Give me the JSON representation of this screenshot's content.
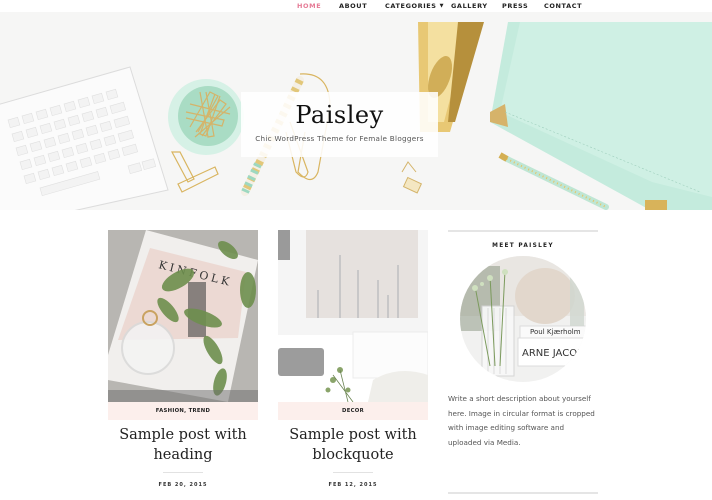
{
  "nav": {
    "items": [
      {
        "label": "HOME",
        "active": true
      },
      {
        "label": "ABOUT"
      },
      {
        "label": "CATEGORIES",
        "has_dropdown": true
      },
      {
        "label": "GALLERY"
      },
      {
        "label": "PRESS"
      },
      {
        "label": "CONTACT"
      }
    ],
    "caret": "▼"
  },
  "header": {
    "title": "Paisley",
    "tagline": "Chic WordPress Theme for Female Bloggers"
  },
  "posts": [
    {
      "categories": "FASHION, TREND",
      "title": "Sample post with heading",
      "date": "FEB 20, 2015",
      "image": "kinfolk-magazine-with-plant"
    },
    {
      "categories": "DECOR",
      "title": "Sample post with blockquote",
      "date": "FEB 12, 2015",
      "image": "white-sofa-living-room"
    }
  ],
  "sidebar": {
    "heading": "MEET PAISLEY",
    "avatar": "vase-and-books",
    "book_text_1": "Poul Kjærholm",
    "book_text_2": "ARNE JACOB",
    "description": "Write a short description about yourself here. Image in circular format is cropped with image editing software and uploaded via Media."
  },
  "colors": {
    "accent": "#e67b96",
    "category_bg": "#fcefec",
    "mint": "#c8ecdf",
    "gold": "#d9b560"
  }
}
